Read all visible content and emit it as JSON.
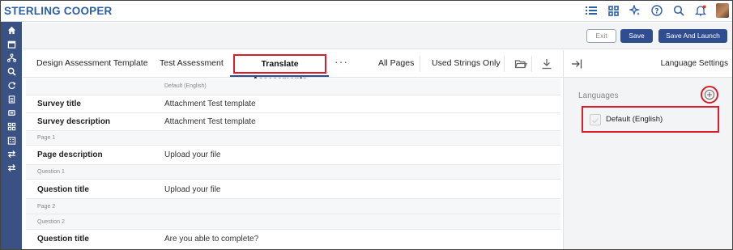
{
  "brand": "STERLING COOPER",
  "topbar": {
    "icons": [
      "list-icon",
      "grid-icon",
      "sparkle-icon",
      "help-icon",
      "search-icon",
      "bell-icon",
      "avatar"
    ]
  },
  "sidebar": {
    "items": [
      "home-icon",
      "calendar-icon",
      "hierarchy-icon",
      "search-icon",
      "refresh-icon",
      "clipboard-icon",
      "swap-icon",
      "apps-icon",
      "building-icon",
      "transfer-icon",
      "transfer-alt-icon"
    ]
  },
  "actions": {
    "exit": "Exit",
    "save": "Save",
    "save_launch": "Save And Launch"
  },
  "tabs": {
    "design": "Design Assessment Template",
    "test": "Test Assessment",
    "translate": "Translate Assessments",
    "more": "···",
    "all_pages": "All Pages",
    "used_strings": "Used Strings Only"
  },
  "table": {
    "column_header": "Default (English)",
    "rows": [
      {
        "key": "Survey title",
        "value": "Attachment Test template"
      },
      {
        "key": "Survey description",
        "value": "Attachment Test template"
      },
      {
        "section": "Page 1"
      },
      {
        "key": "Page description",
        "value": "Upload your file"
      },
      {
        "section": "Question 1"
      },
      {
        "key": "Question title",
        "value": "Upload your file"
      },
      {
        "section": "Page 2"
      },
      {
        "section": "Question 2"
      },
      {
        "key": "Question title",
        "value": "Are you able to complete?"
      }
    ]
  },
  "right_panel": {
    "title": "Language Settings",
    "languages_label": "Languages",
    "languages": [
      {
        "name": "Default (English)",
        "checked": false
      }
    ]
  },
  "colors": {
    "brand": "#2c5fa8",
    "sidebar": "#3a5184",
    "primary_button": "#2f4d8f",
    "highlight": "#d81f2a"
  }
}
